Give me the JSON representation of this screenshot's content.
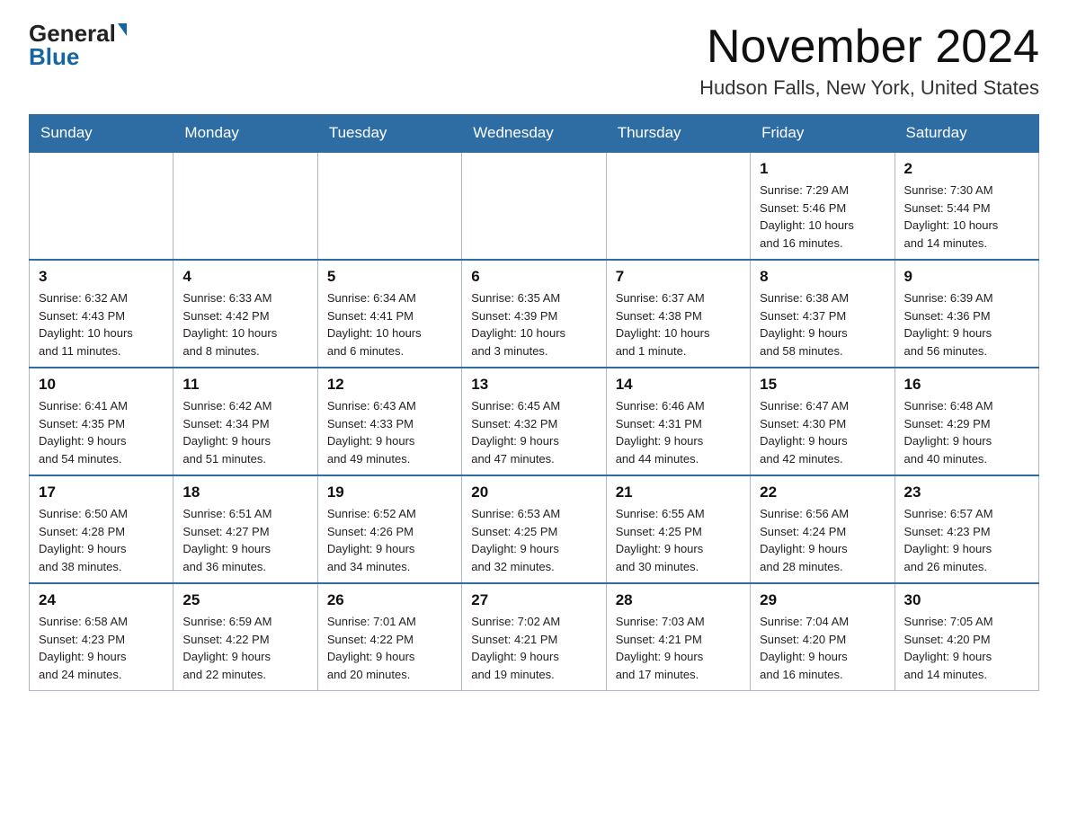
{
  "logo": {
    "general": "General",
    "blue": "Blue"
  },
  "header": {
    "title": "November 2024",
    "location": "Hudson Falls, New York, United States"
  },
  "weekdays": [
    "Sunday",
    "Monday",
    "Tuesday",
    "Wednesday",
    "Thursday",
    "Friday",
    "Saturday"
  ],
  "weeks": [
    [
      {
        "day": "",
        "info": ""
      },
      {
        "day": "",
        "info": ""
      },
      {
        "day": "",
        "info": ""
      },
      {
        "day": "",
        "info": ""
      },
      {
        "day": "",
        "info": ""
      },
      {
        "day": "1",
        "info": "Sunrise: 7:29 AM\nSunset: 5:46 PM\nDaylight: 10 hours\nand 16 minutes."
      },
      {
        "day": "2",
        "info": "Sunrise: 7:30 AM\nSunset: 5:44 PM\nDaylight: 10 hours\nand 14 minutes."
      }
    ],
    [
      {
        "day": "3",
        "info": "Sunrise: 6:32 AM\nSunset: 4:43 PM\nDaylight: 10 hours\nand 11 minutes."
      },
      {
        "day": "4",
        "info": "Sunrise: 6:33 AM\nSunset: 4:42 PM\nDaylight: 10 hours\nand 8 minutes."
      },
      {
        "day": "5",
        "info": "Sunrise: 6:34 AM\nSunset: 4:41 PM\nDaylight: 10 hours\nand 6 minutes."
      },
      {
        "day": "6",
        "info": "Sunrise: 6:35 AM\nSunset: 4:39 PM\nDaylight: 10 hours\nand 3 minutes."
      },
      {
        "day": "7",
        "info": "Sunrise: 6:37 AM\nSunset: 4:38 PM\nDaylight: 10 hours\nand 1 minute."
      },
      {
        "day": "8",
        "info": "Sunrise: 6:38 AM\nSunset: 4:37 PM\nDaylight: 9 hours\nand 58 minutes."
      },
      {
        "day": "9",
        "info": "Sunrise: 6:39 AM\nSunset: 4:36 PM\nDaylight: 9 hours\nand 56 minutes."
      }
    ],
    [
      {
        "day": "10",
        "info": "Sunrise: 6:41 AM\nSunset: 4:35 PM\nDaylight: 9 hours\nand 54 minutes."
      },
      {
        "day": "11",
        "info": "Sunrise: 6:42 AM\nSunset: 4:34 PM\nDaylight: 9 hours\nand 51 minutes."
      },
      {
        "day": "12",
        "info": "Sunrise: 6:43 AM\nSunset: 4:33 PM\nDaylight: 9 hours\nand 49 minutes."
      },
      {
        "day": "13",
        "info": "Sunrise: 6:45 AM\nSunset: 4:32 PM\nDaylight: 9 hours\nand 47 minutes."
      },
      {
        "day": "14",
        "info": "Sunrise: 6:46 AM\nSunset: 4:31 PM\nDaylight: 9 hours\nand 44 minutes."
      },
      {
        "day": "15",
        "info": "Sunrise: 6:47 AM\nSunset: 4:30 PM\nDaylight: 9 hours\nand 42 minutes."
      },
      {
        "day": "16",
        "info": "Sunrise: 6:48 AM\nSunset: 4:29 PM\nDaylight: 9 hours\nand 40 minutes."
      }
    ],
    [
      {
        "day": "17",
        "info": "Sunrise: 6:50 AM\nSunset: 4:28 PM\nDaylight: 9 hours\nand 38 minutes."
      },
      {
        "day": "18",
        "info": "Sunrise: 6:51 AM\nSunset: 4:27 PM\nDaylight: 9 hours\nand 36 minutes."
      },
      {
        "day": "19",
        "info": "Sunrise: 6:52 AM\nSunset: 4:26 PM\nDaylight: 9 hours\nand 34 minutes."
      },
      {
        "day": "20",
        "info": "Sunrise: 6:53 AM\nSunset: 4:25 PM\nDaylight: 9 hours\nand 32 minutes."
      },
      {
        "day": "21",
        "info": "Sunrise: 6:55 AM\nSunset: 4:25 PM\nDaylight: 9 hours\nand 30 minutes."
      },
      {
        "day": "22",
        "info": "Sunrise: 6:56 AM\nSunset: 4:24 PM\nDaylight: 9 hours\nand 28 minutes."
      },
      {
        "day": "23",
        "info": "Sunrise: 6:57 AM\nSunset: 4:23 PM\nDaylight: 9 hours\nand 26 minutes."
      }
    ],
    [
      {
        "day": "24",
        "info": "Sunrise: 6:58 AM\nSunset: 4:23 PM\nDaylight: 9 hours\nand 24 minutes."
      },
      {
        "day": "25",
        "info": "Sunrise: 6:59 AM\nSunset: 4:22 PM\nDaylight: 9 hours\nand 22 minutes."
      },
      {
        "day": "26",
        "info": "Sunrise: 7:01 AM\nSunset: 4:22 PM\nDaylight: 9 hours\nand 20 minutes."
      },
      {
        "day": "27",
        "info": "Sunrise: 7:02 AM\nSunset: 4:21 PM\nDaylight: 9 hours\nand 19 minutes."
      },
      {
        "day": "28",
        "info": "Sunrise: 7:03 AM\nSunset: 4:21 PM\nDaylight: 9 hours\nand 17 minutes."
      },
      {
        "day": "29",
        "info": "Sunrise: 7:04 AM\nSunset: 4:20 PM\nDaylight: 9 hours\nand 16 minutes."
      },
      {
        "day": "30",
        "info": "Sunrise: 7:05 AM\nSunset: 4:20 PM\nDaylight: 9 hours\nand 14 minutes."
      }
    ]
  ]
}
